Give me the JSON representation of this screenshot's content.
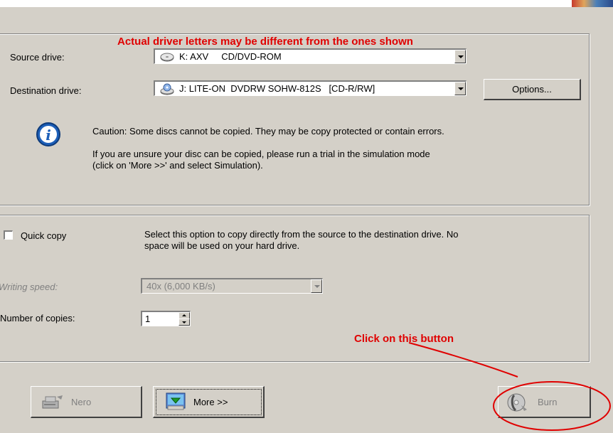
{
  "annotations": {
    "top_note": "Actual driver letters may be different from the ones shown",
    "button_note": "Click on this button"
  },
  "drives": {
    "source_label": "Source drive:",
    "source_value": "K: AXV     CD/DVD-ROM",
    "destination_label": "Destination drive:",
    "destination_value": "J: LITE-ON  DVDRW SOHW-812S   [CD-R/RW]",
    "options_label": "Options..."
  },
  "caution": {
    "line1": "Caution: Some discs cannot be copied. They may be copy protected or contain errors.",
    "line2": "If you are unsure your disc can be copied, please run a trial in the simulation mode",
    "line3": "(click on 'More >>' and select Simulation)."
  },
  "copy": {
    "quick_copy_label": "Quick copy",
    "quick_copy_checked": false,
    "quick_copy_desc1": "Select this option to copy directly from the source to the destination drive. No",
    "quick_copy_desc2": "space will be used on your hard drive.",
    "writing_speed_label": "Writing speed:",
    "writing_speed_value": "40x (6,000 KB/s)",
    "copies_label": "Number of copies:",
    "copies_value": "1"
  },
  "buttons": {
    "nero_label": "Nero",
    "more_label": "More >>",
    "burn_label": "Burn"
  },
  "colors": {
    "annotation": "#e00000",
    "dialog_bg": "#d4d0c8",
    "info_icon": "#1d5fb8"
  }
}
